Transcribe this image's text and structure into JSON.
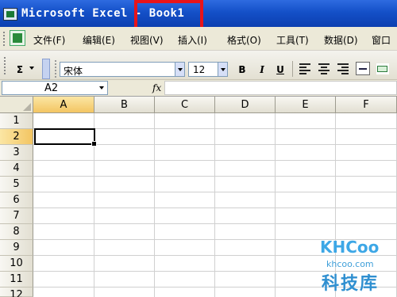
{
  "window": {
    "title": "Microsoft Excel - Book1",
    "highlight_color": "#e8141a"
  },
  "menu": [
    "文件(F)",
    "编辑(E)",
    "视图(V)",
    "插入(I)",
    "格式(O)",
    "工具(T)",
    "数据(D)",
    "窗口"
  ],
  "toolbar": {
    "sum_label": "Σ",
    "font_name": "宋体",
    "font_size": "12",
    "bold_label": "B",
    "italic_label": "I",
    "underline_label": "U"
  },
  "formula_bar": {
    "name_box": "A2",
    "fx_label": "fx",
    "formula": ""
  },
  "sheet": {
    "columns": [
      "A",
      "B",
      "C",
      "D",
      "E",
      "F"
    ],
    "rows": [
      "1",
      "2",
      "3",
      "4",
      "5",
      "6",
      "7",
      "8",
      "9",
      "10",
      "11",
      "12"
    ],
    "active_cell": "A2"
  },
  "watermark": {
    "logo": "KHCoo",
    "domain": "khcoo.com",
    "name": "科技库"
  }
}
